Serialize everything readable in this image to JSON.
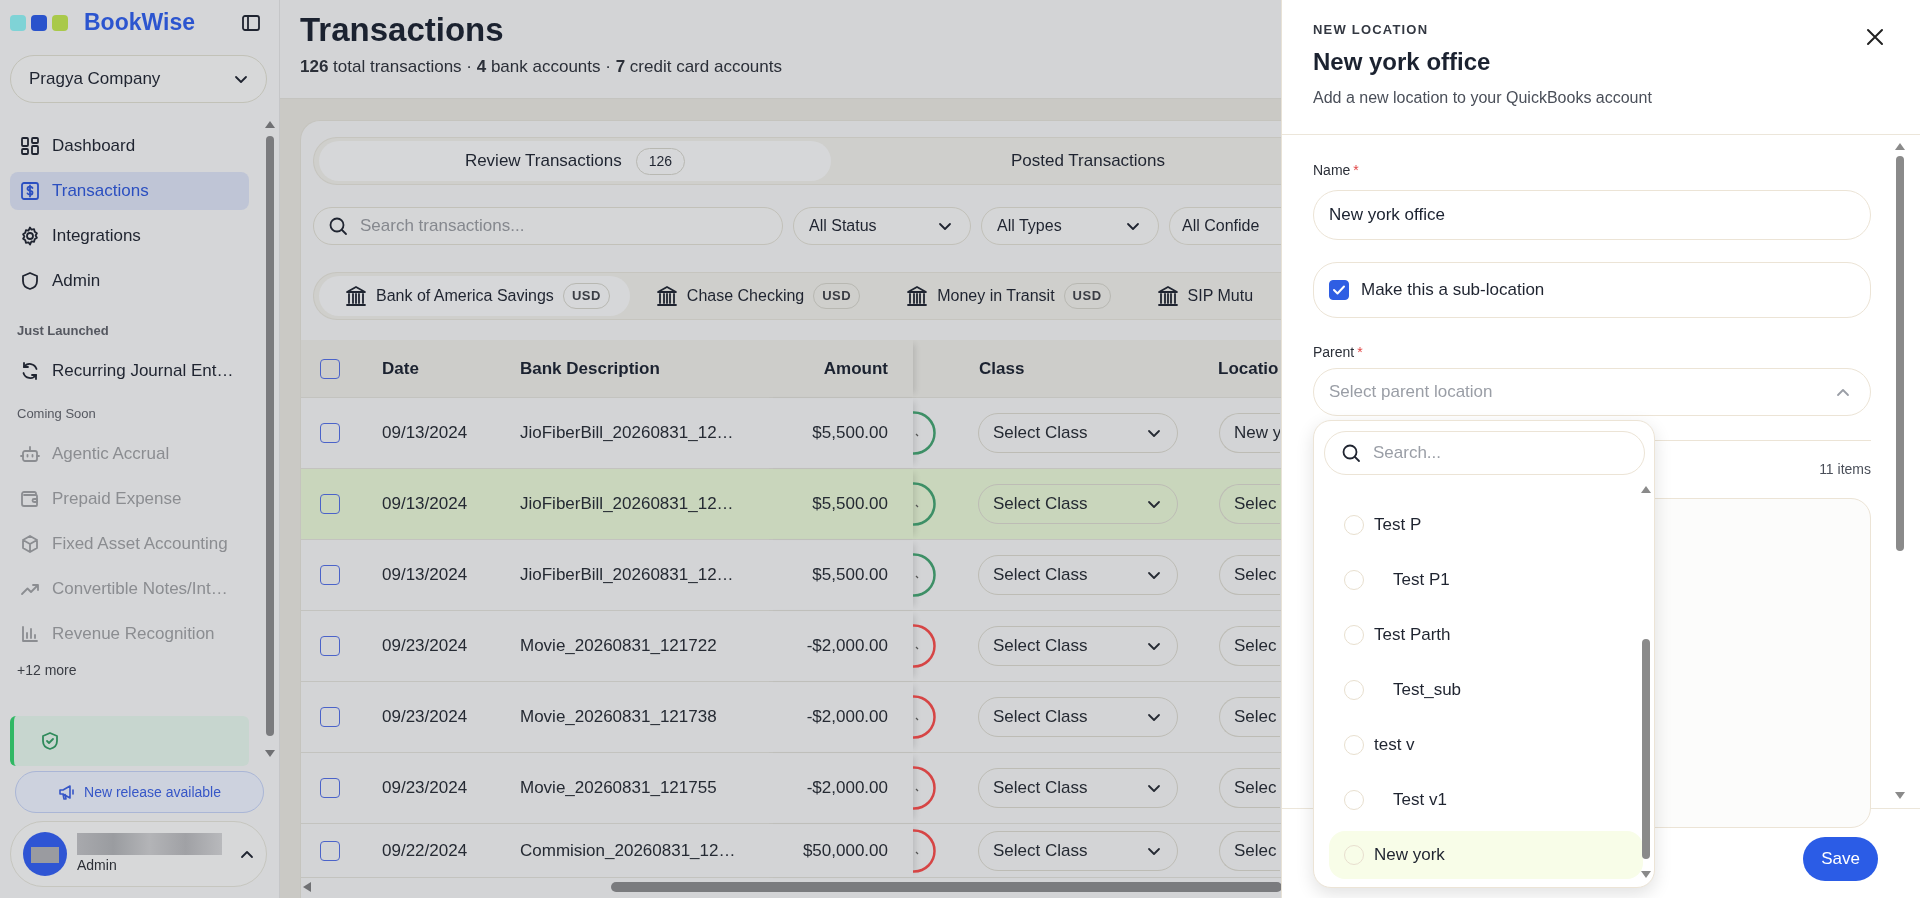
{
  "sidebar": {
    "brand": "BookWise",
    "company": "Pragya Company",
    "nav_items": [
      {
        "label": "Dashboard",
        "selected": false
      },
      {
        "label": "Transactions",
        "selected": true
      },
      {
        "label": "Integrations",
        "selected": false
      },
      {
        "label": "Admin",
        "selected": false
      }
    ],
    "just_launched": {
      "heading": "Just Launched",
      "items": [
        {
          "label": "Recurring Journal Ent…"
        }
      ]
    },
    "coming_soon": {
      "heading": "Coming Soon",
      "items": [
        {
          "label": "Agentic Accrual",
          "disabled": true
        },
        {
          "label": "Prepaid Expense",
          "disabled": true
        },
        {
          "label": "Fixed Asset Accounting",
          "disabled": true
        },
        {
          "label": "Convertible Notes/Int…",
          "disabled": true
        },
        {
          "label": "Revenue Recognition",
          "disabled": true
        }
      ],
      "more": "+12 more"
    },
    "release_button": "New release available",
    "user": {
      "role": "Admin"
    }
  },
  "page": {
    "title": "Transactions",
    "summary": "**126** total transactions · **4** bank accounts · **7** credit card accounts"
  },
  "tabs": [
    {
      "label": "Review Transactions",
      "count": "126",
      "selected": true
    },
    {
      "label": "Posted Transactions",
      "selected": false
    }
  ],
  "search": {
    "placeholder": "Search transactions..."
  },
  "filters": [
    "All Status",
    "All Types",
    "All Confide"
  ],
  "accounts": [
    {
      "name": "Bank of America Savings",
      "currency": "USD",
      "selected": true
    },
    {
      "name": "Chase Checking",
      "currency": "USD",
      "selected": false
    },
    {
      "name": "Money in Transit",
      "currency": "USD",
      "selected": false
    },
    {
      "name": "SIP Mutu",
      "selected": false
    }
  ],
  "table": {
    "select_all": {
      "checked": false
    },
    "columns": [
      "Date",
      "Bank Description",
      "Amount",
      "Class",
      "Locatio"
    ],
    "rows": [
      {
        "checked": false,
        "selected": false,
        "date": "09/13/2024",
        "description": "JioFiberBill_20260831_12…",
        "amount": "$5,500.00",
        "color": "#3d8f66",
        "class": "Select Class",
        "location": "New y"
      },
      {
        "checked": false,
        "selected": true,
        "date": "09/13/2024",
        "description": "JioFiberBill_20260831_12…",
        "amount": "$5,500.00",
        "color": "#3d8f66",
        "class": "Select Class",
        "location": "Selec"
      },
      {
        "checked": false,
        "selected": false,
        "date": "09/13/2024",
        "description": "JioFiberBill_20260831_12…",
        "amount": "$5,500.00",
        "color": "#3d8f66",
        "class": "Select Class",
        "location": "Selec"
      },
      {
        "checked": false,
        "selected": false,
        "date": "09/23/2024",
        "description": "Movie_20260831_121722",
        "amount": "-$2,000.00",
        "color": "#d64545",
        "class": "Select Class",
        "location": "Selec"
      },
      {
        "checked": false,
        "selected": false,
        "date": "09/23/2024",
        "description": "Movie_20260831_121738",
        "amount": "-$2,000.00",
        "color": "#d64545",
        "class": "Select Class",
        "location": "Selec"
      },
      {
        "checked": false,
        "selected": false,
        "date": "09/23/2024",
        "description": "Movie_20260831_121755",
        "amount": "-$2,000.00",
        "color": "#d64545",
        "class": "Select Class",
        "location": "Selec"
      },
      {
        "checked": false,
        "selected": false,
        "date": "09/22/2024",
        "description": "Commision_20260831_12…",
        "amount": "$50,000.00",
        "color": "#d64545",
        "class": "Select Class",
        "location": "Selec"
      }
    ]
  },
  "drawer": {
    "eyebrow": "NEW LOCATION",
    "title": "New york office",
    "subtitle": "Add a new location to your QuickBooks account",
    "name_field": {
      "label": "Name",
      "required_mark": "*",
      "value": "New york office"
    },
    "sub_location": {
      "label": "Make this a sub-location",
      "checked": true
    },
    "parent_field": {
      "label": "Parent",
      "required_mark": "*",
      "placeholder": "Select parent location",
      "expanded": true
    },
    "items_count": "11 items",
    "dropdown": {
      "placeholder": "Search...",
      "options": [
        {
          "label": "Test P",
          "highlighted": false,
          "children": [
            {
              "label": "Test P1",
              "highlighted": false
            }
          ]
        },
        {
          "label": "Test Parth",
          "highlighted": false,
          "children": [
            {
              "label": "Test_sub",
              "highlighted": false
            }
          ]
        },
        {
          "label": "test v",
          "highlighted": false,
          "children": [
            {
              "label": "Test v1",
              "highlighted": false
            }
          ]
        },
        {
          "label": "New york",
          "highlighted": true
        }
      ]
    },
    "save": "Save"
  }
}
